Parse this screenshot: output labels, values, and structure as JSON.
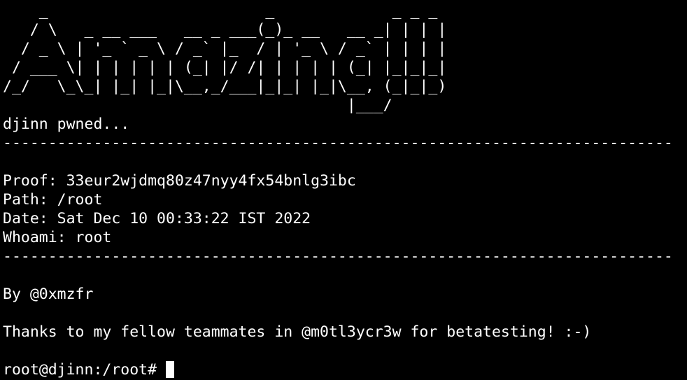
{
  "banner": {
    "lines": [
      "    _                        _             _ _ _ ",
      "   / \\   _ __ ___   __ _ ___(_)_ __   __ _| | | |",
      "  / _ \\ | '_ ` _ \\ / _` |_  / | '_ \\ / _` | | | |",
      " / ___ \\| | | | | | (_| |/ /| | | | | (_| |_|_|_|",
      "/_/   \\_\\_| |_| |_|\\__,_/___|_|_| |_|\\__, (_|_|_)",
      "                                      |___/      "
    ]
  },
  "status": "djinn pwned...",
  "separator": "--------------------------------------------------------------------------",
  "info": {
    "proof": "Proof: 33eur2wjdmq80z47nyy4fx54bnlg3ibc",
    "path": "Path: /root",
    "date": "Date: Sat Dec 10 00:33:22 IST 2022",
    "whoami": "Whoami: root"
  },
  "author": "By @0xmzfr",
  "thanks": "Thanks to my fellow teammates in @m0tl3ycr3w for betatesting! :-)",
  "prompt": "root@djinn:/root#"
}
